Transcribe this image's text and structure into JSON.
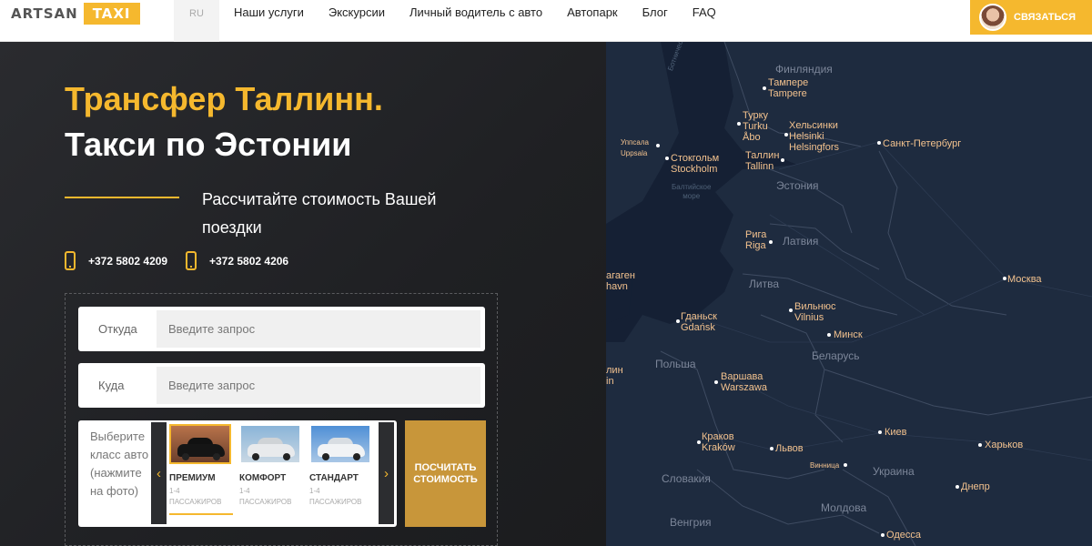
{
  "header": {
    "logo_word": "ARTSAN",
    "logo_badge": "TAXI",
    "lang": "RU",
    "nav": [
      "Наши услуги",
      "Экскурсии",
      "Личный водитель с авто",
      "Автопарк",
      "Блог",
      "FAQ"
    ],
    "contact_label": "СВЯЗАТЬСЯ"
  },
  "hero": {
    "title_line1": "Трансфер Таллинн.",
    "title_line2": "Такси по Эстонии",
    "subtitle": "Рассчитайте стоимость Вашей поездки",
    "phones": [
      "+372 5802 4209",
      "+372 5802 4206"
    ]
  },
  "form": {
    "from_label": "Откуда",
    "from_placeholder": "Введите запрос",
    "to_label": "Куда",
    "to_placeholder": "Введите запрос",
    "car_prompt": "Выберите класс авто (нажмите на фото)",
    "cars": [
      {
        "name": "ПРЕМИУМ",
        "seats": "1-4",
        "caption": "ПАССАЖИРОВ",
        "selected": true
      },
      {
        "name": "КОМФОРТ",
        "seats": "1-4",
        "caption": "ПАССАЖИРОВ",
        "selected": false
      },
      {
        "name": "СТАНДАРТ",
        "seats": "1-4",
        "caption": "ПАССАЖИРОВ",
        "selected": false
      }
    ],
    "prev_arrow": "‹",
    "next_arrow": "›",
    "calc_button": "ПОСЧИТАТЬ СТОИМОСТЬ"
  },
  "map": {
    "cities": {
      "tampere": "Тампере\nTampere",
      "turku": "Турку\nTurku\nÅbo",
      "helsinki": "Хельсинки\nHelsinki\nHelsingfors",
      "spb": "Санкт-Петербург",
      "uppsala": "Уппсала\nUppsala",
      "stockholm": "Стокгольм\nStockholm",
      "tallinn": "Таллин\nTallinn",
      "riga": "Рига\nRiga",
      "moscow": "Москва",
      "copenhagen": "агаген\nhavn",
      "vilnius": "Вильнюс\nVilnius",
      "gdansk": "Гданьск\nGdańsk",
      "minsk": "Минск",
      "berlin": "лин\nin",
      "warsaw": "Варшава\nWarszawa",
      "krakow": "Краков\nKraków",
      "lviv": "Львов",
      "kiev": "Киев",
      "kharkov": "Харьков",
      "vinnitsa": "Винница",
      "dnepr": "Днепр",
      "odessa": "Одесса"
    },
    "countries": {
      "finland": "Финляндия",
      "estonia": "Эстония",
      "latvia": "Латвия",
      "lithuania": "Литва",
      "poland": "Польша",
      "belarus": "Беларусь",
      "ukraine": "Украина",
      "slovakia": "Словакия",
      "moldova": "Молдова",
      "hungary": "Венгрия"
    },
    "seas": {
      "baltic": "Балтийское\nморе",
      "bothnia": "Ботнический залив"
    }
  }
}
